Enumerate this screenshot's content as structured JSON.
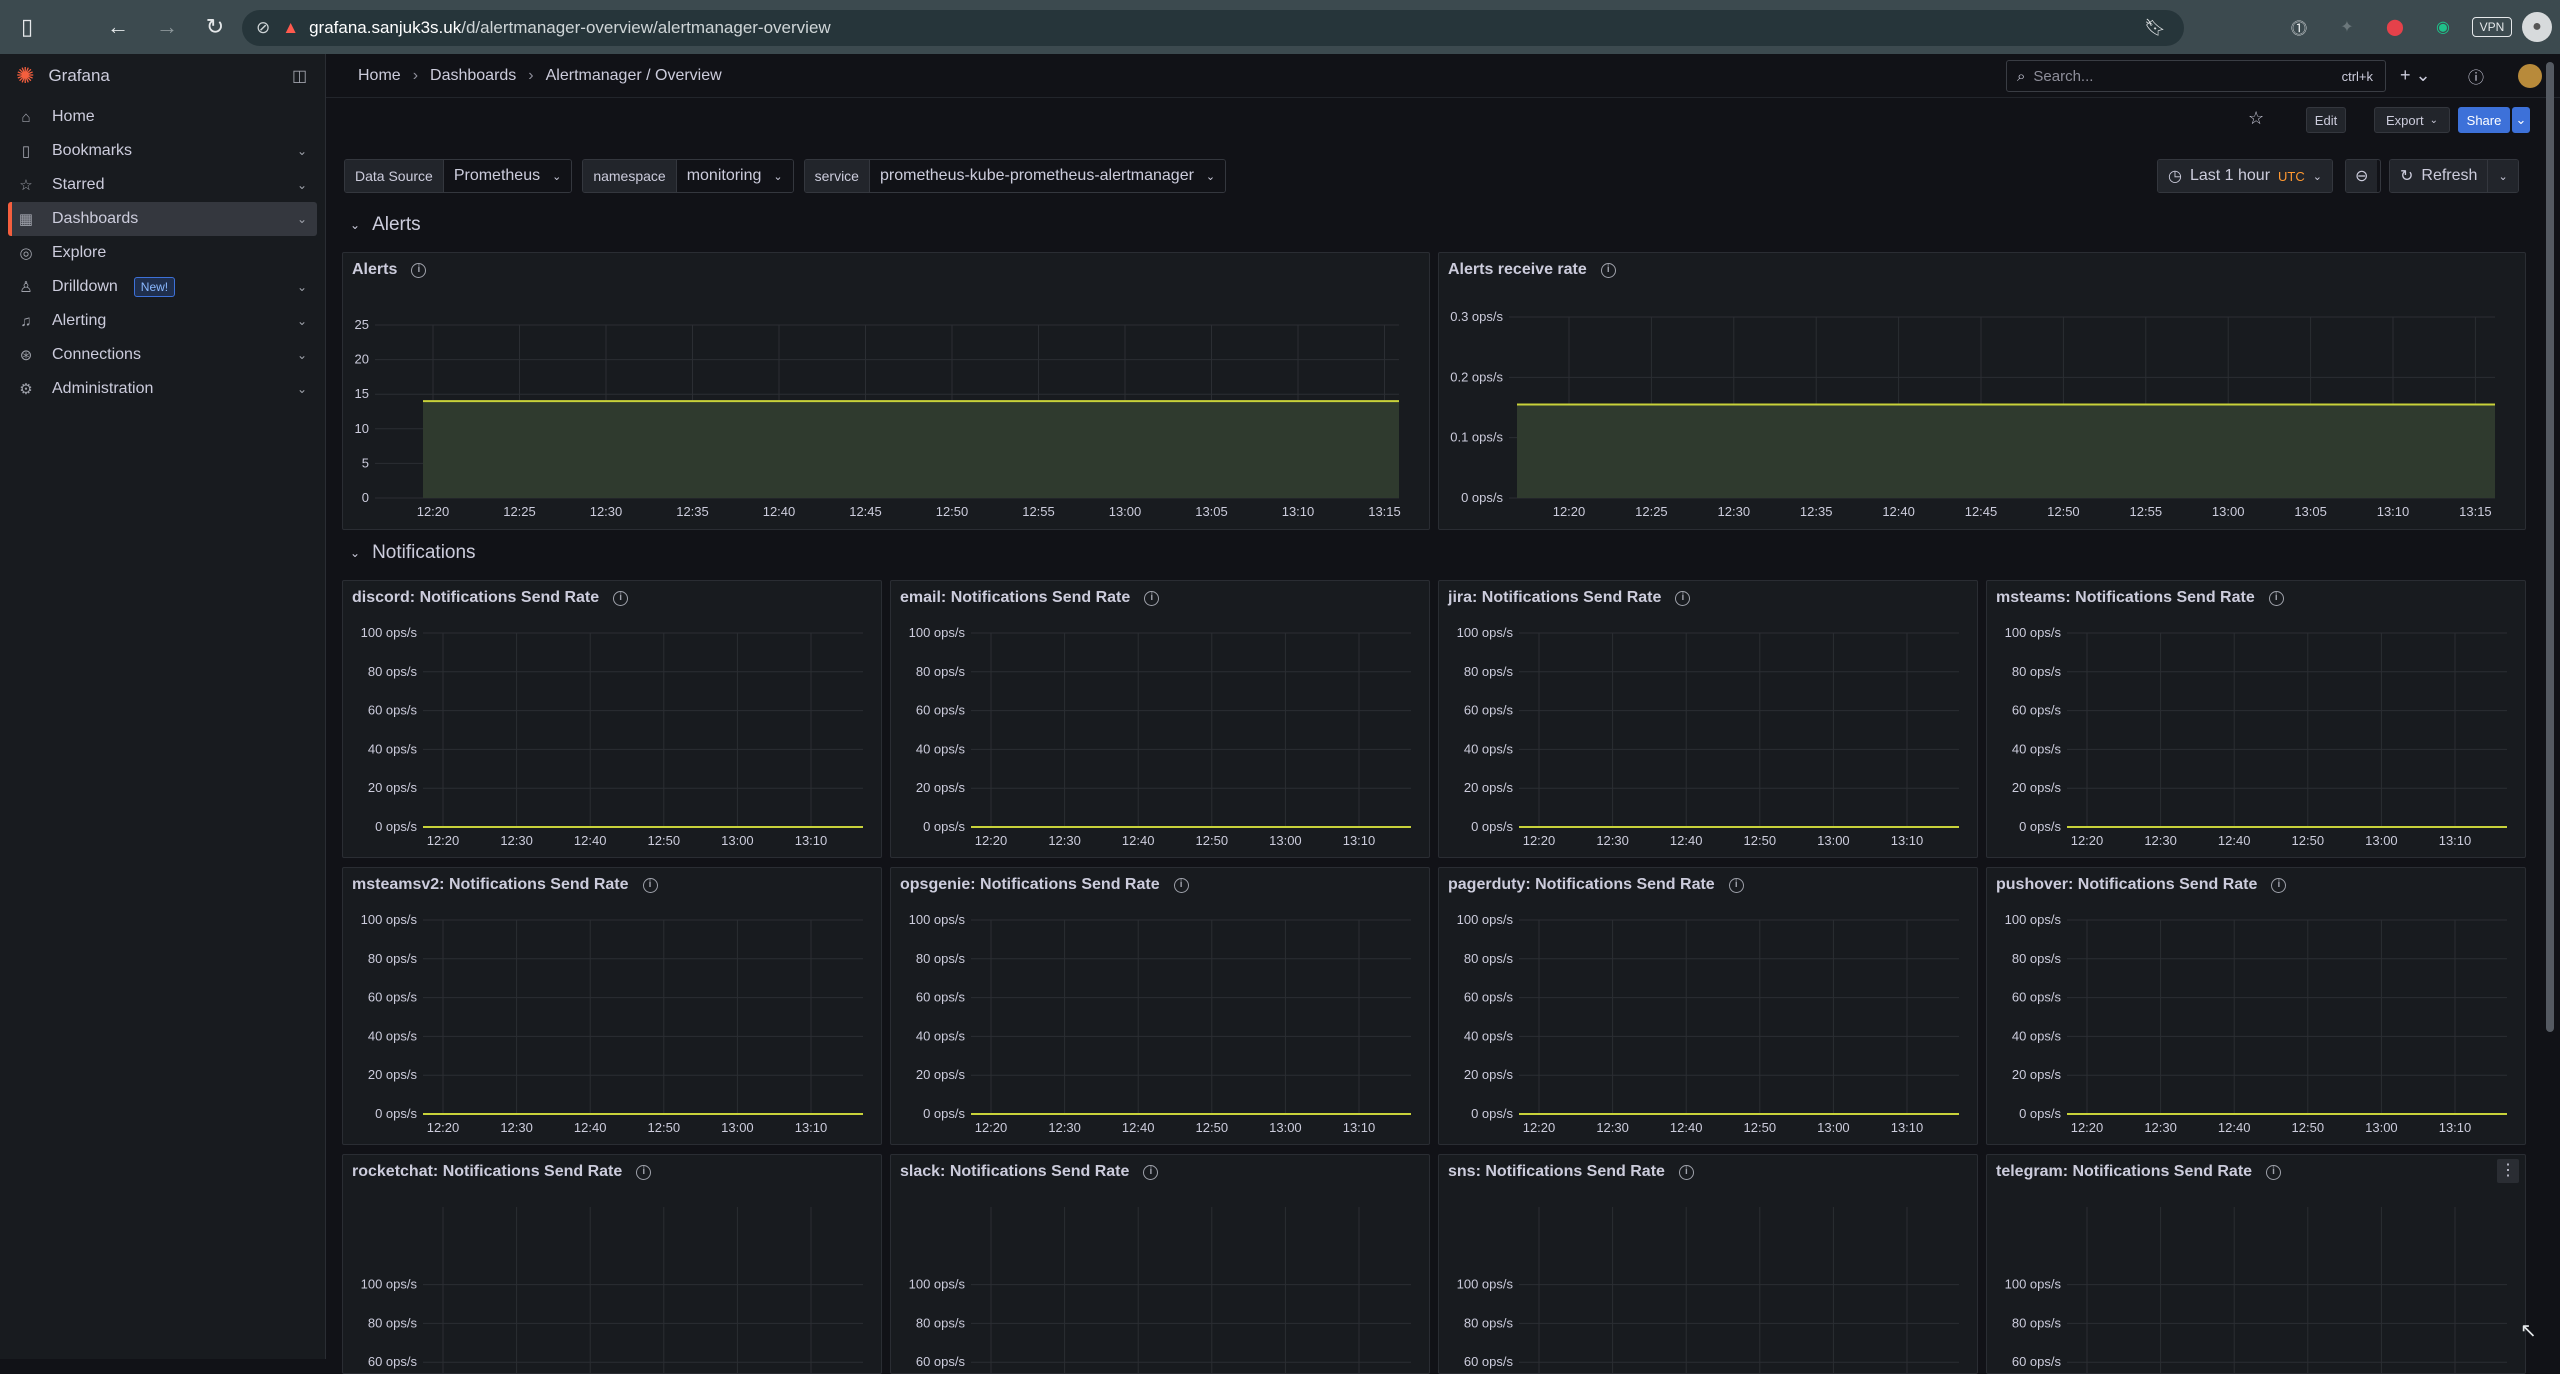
{
  "browser": {
    "url_domain": "grafana.sanjuk3s.uk",
    "url_path": "/d/alertmanager-overview/alertmanager-overview",
    "vpn_label": "VPN"
  },
  "sidebar": {
    "brand": "Grafana",
    "items": [
      {
        "label": "Home",
        "icon": "home-icon",
        "chevron": false
      },
      {
        "label": "Bookmarks",
        "icon": "bookmark-icon",
        "chevron": true
      },
      {
        "label": "Starred",
        "icon": "star-icon",
        "chevron": true
      },
      {
        "label": "Dashboards",
        "icon": "dashboards-icon",
        "chevron": true,
        "active": true
      },
      {
        "label": "Explore",
        "icon": "compass-icon",
        "chevron": false
      },
      {
        "label": "Drilldown",
        "icon": "drilldown-icon",
        "chevron": true,
        "badge": "New!"
      },
      {
        "label": "Alerting",
        "icon": "bell-icon",
        "chevron": true
      },
      {
        "label": "Connections",
        "icon": "connections-icon",
        "chevron": true
      },
      {
        "label": "Administration",
        "icon": "gear-icon",
        "chevron": true
      }
    ]
  },
  "breadcrumb": [
    "Home",
    "Dashboards",
    "Alertmanager / Overview"
  ],
  "search": {
    "placeholder": "Search...",
    "shortcut": "ctrl+k"
  },
  "toolbar": {
    "edit": "Edit",
    "export": "Export",
    "share": "Share",
    "time_range": "Last 1 hour",
    "timezone": "UTC",
    "refresh": "Refresh"
  },
  "variables": [
    {
      "label": "Data Source",
      "value": "Prometheus"
    },
    {
      "label": "namespace",
      "value": "monitoring"
    },
    {
      "label": "service",
      "value": "prometheus-kube-prometheus-alertmanager"
    }
  ],
  "rows": {
    "alerts": "Alerts",
    "notifications": "Notifications"
  },
  "alerts_panels": [
    {
      "title": "Alerts",
      "yticks": [
        "25",
        "20",
        "15",
        "10",
        "5",
        "0"
      ],
      "xticks": [
        "12:20",
        "12:25",
        "12:30",
        "12:35",
        "12:40",
        "12:45",
        "12:50",
        "12:55",
        "13:00",
        "13:05",
        "13:10",
        "13:15"
      ],
      "ymax": 25,
      "value": 14
    },
    {
      "title": "Alerts receive rate",
      "yticks": [
        "0.3 ops/s",
        "0.2 ops/s",
        "0.1 ops/s",
        "0 ops/s"
      ],
      "xticks": [
        "12:20",
        "12:25",
        "12:30",
        "12:35",
        "12:40",
        "12:45",
        "12:50",
        "12:55",
        "13:00",
        "13:05",
        "13:10",
        "13:15"
      ],
      "ymax": 0.3,
      "value": 0.155
    }
  ],
  "notif_yticks": [
    "100 ops/s",
    "80 ops/s",
    "60 ops/s",
    "40 ops/s",
    "20 ops/s",
    "0 ops/s"
  ],
  "notif_yticks_partial": [
    "100 ops/s",
    "80 ops/s",
    "60 ops/s",
    "40 ops/s"
  ],
  "notif_xticks": [
    "12:20",
    "12:30",
    "12:40",
    "12:50",
    "13:00",
    "13:10"
  ],
  "notif_panels": [
    "discord: Notifications Send Rate",
    "email: Notifications Send Rate",
    "jira: Notifications Send Rate",
    "msteams: Notifications Send Rate",
    "msteamsv2: Notifications Send Rate",
    "opsgenie: Notifications Send Rate",
    "pagerduty: Notifications Send Rate",
    "pushover: Notifications Send Rate",
    "rocketchat: Notifications Send Rate",
    "slack: Notifications Send Rate",
    "sns: Notifications Send Rate",
    "telegram: Notifications Send Rate"
  ],
  "colors": {
    "series": "#c8d23a",
    "fill": "#2f3a2e",
    "accent": "#3d71d9",
    "brand": "#f55f3e"
  }
}
